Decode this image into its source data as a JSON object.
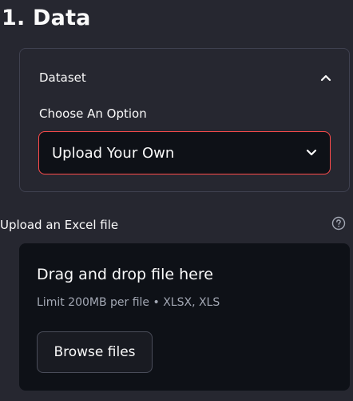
{
  "section": {
    "title": "1. Data"
  },
  "expander": {
    "label": "Dataset",
    "expanded": true,
    "chevron_icon": "chevron-up-icon"
  },
  "select": {
    "label": "Choose An Option",
    "value": "Upload Your Own",
    "chevron_icon": "chevron-down-icon",
    "focus_border_color": "#ff4b4b"
  },
  "uploader": {
    "label": "Upload an Excel file",
    "help_icon": "question-circle-icon",
    "dropzone_title": "Drag and drop file here",
    "dropzone_limit": "Limit 200MB per file • XLSX, XLS",
    "browse_label": "Browse files"
  },
  "colors": {
    "background": "#262730",
    "input_background": "#0e1117",
    "text": "#fafafa",
    "muted_text": "#a3a8b4",
    "accent": "#ff4b4b"
  }
}
